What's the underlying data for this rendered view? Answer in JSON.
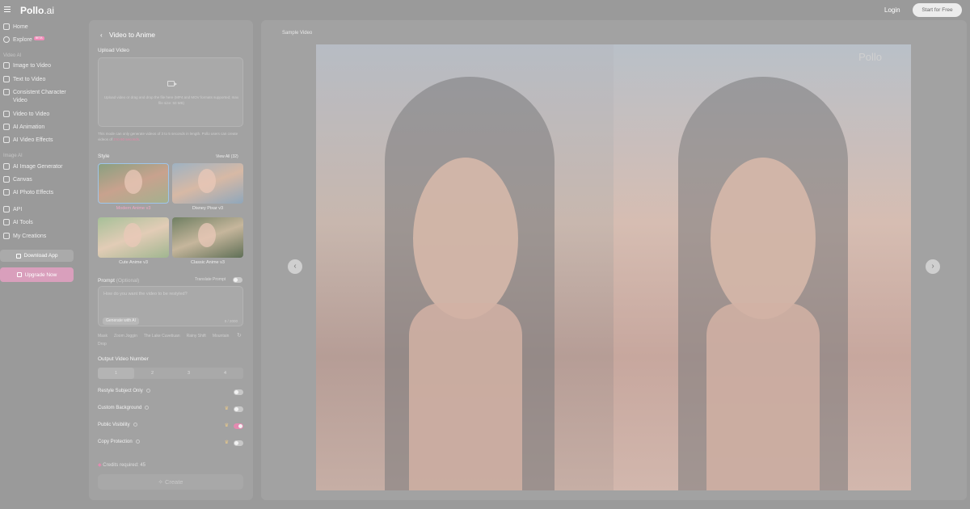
{
  "header": {
    "logo": "Pollo",
    "logo_suffix": ".ai",
    "login_label": "Login",
    "start_label": "Start for Free"
  },
  "sidebar": {
    "home": "Home",
    "explore": "Explore",
    "explore_badge": "BETA",
    "video_ai": "Video AI",
    "image_to_video": "Image to Video",
    "text_to_video": "Text to Video",
    "consistent_character": "Consistent Character Video",
    "video_to_video": "Video to Video",
    "ai_animation": "AI Animation",
    "ai_video_effects": "AI Video Effects",
    "image_ai": "Image AI",
    "ai_image_generator": "AI Image Generator",
    "canvas": "Canvas",
    "ai_photo_effects": "AI Photo Effects",
    "api": "API",
    "ai_tools": "AI Tools",
    "my_creations": "My Creations",
    "download_app": "Download App",
    "upgrade_now": "Upgrade Now"
  },
  "panel": {
    "back_icon": "chevron-left-icon",
    "title": "Video to Anime",
    "upload_label": "Upload Video",
    "upload_hint": "Upload video or drag and drop the file here (MP4 and MOV formats supported; max file size: 50 MB)",
    "note": "This mode can only generate videos of 3 to 5 seconds in length. Pollo users can create videos of ",
    "note_highlight": "3 to 60 seconds",
    "note_end": ".",
    "style_label": "Style",
    "view_all": "View All (32)",
    "styles": [
      {
        "name": "Modern Anime v3"
      },
      {
        "name": "Disney Pixar v3"
      },
      {
        "name": "Cute Anime v3"
      },
      {
        "name": "Classic Anime v3"
      }
    ],
    "prompt_label": "Prompt",
    "prompt_optional": "(Optional)",
    "translate_label": "Translate Prompt",
    "prompt_placeholder": "How do you want the video to be restyled?",
    "generate_ai": "Generate with AI",
    "char_count": "0 / 2000",
    "tags": [
      "Mask",
      "Zoom Joggin",
      "The Lake Cuvetiuan",
      "Rainy Shift",
      "Mountain Drop"
    ],
    "output_label": "Output Video Number",
    "numbers": [
      "1",
      "2",
      "3",
      "4"
    ],
    "restyle_label": "Restyle Subject Only",
    "custom_bg_label": "Custom Background",
    "public_label": "Public Visibility",
    "copy_label": "Copy Protection",
    "credits_label": "Credits required:",
    "credits_value": "45",
    "create_label": "Create"
  },
  "preview": {
    "sample_label": "Sample Video",
    "watermark": "Pollo",
    "prev_icon": "chevron-left-icon",
    "next_icon": "chevron-right-icon"
  }
}
